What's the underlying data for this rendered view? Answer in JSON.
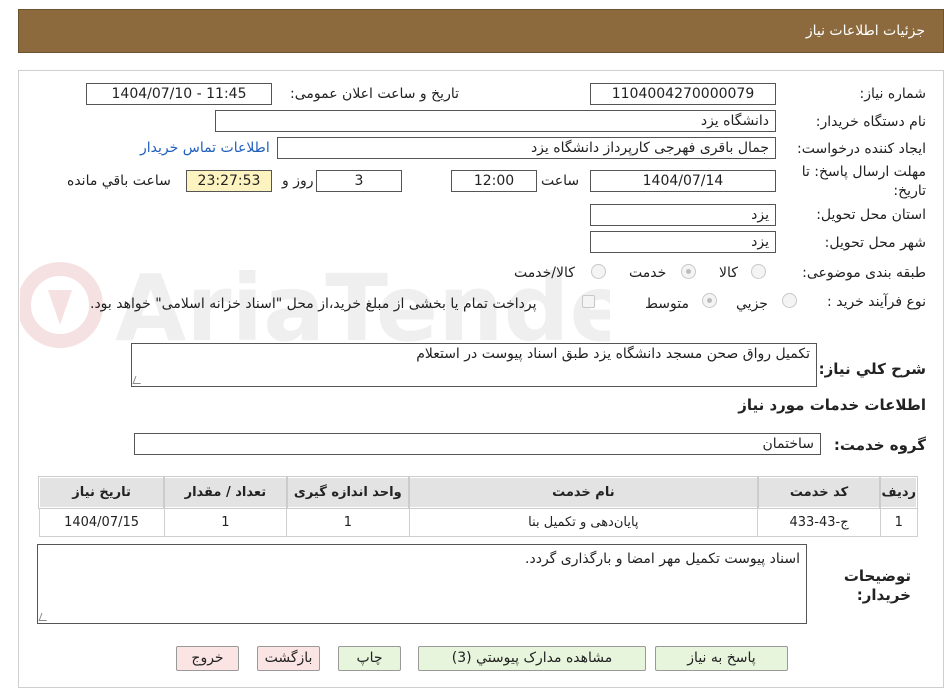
{
  "header": {
    "title": "جزئیات اطلاعات نیاز"
  },
  "form": {
    "need_number_label": "شماره نیاز:",
    "need_number": "1104004270000079",
    "announce_label": "تاریخ و ساعت اعلان عمومی:",
    "announce_value": "1404/07/10 - 11:45",
    "buyer_org_label": "نام دستگاه خریدار:",
    "buyer_org": "دانشگاه یزد",
    "creator_label": "ایجاد کننده درخواست:",
    "creator": "جمال باقری فهرجی کارپرداز دانشگاه یزد",
    "contact_link": "اطلاعات تماس خریدار",
    "deadline_label_1": "مهلت ارسال پاسخ: تا",
    "deadline_label_2": "تاریخ:",
    "deadline_date": "1404/07/14",
    "time_label": "ساعت",
    "deadline_time": "12:00",
    "days": "3",
    "days_label": "روز و",
    "remaining": "23:27:53",
    "remaining_label": "ساعت باقي مانده",
    "province_label": "استان محل تحویل:",
    "province": "یزد",
    "city_label": "شهر محل تحویل:",
    "city": "یزد",
    "category_label": "طبقه بندی موضوعی:",
    "category_options": [
      "کالا",
      "خدمت",
      "کالا/خدمت"
    ],
    "process_label": "نوع فرآیند خرید :",
    "process_options": [
      "جزيي",
      "متوسط"
    ],
    "payment_note": "پرداخت تمام یا بخشی از مبلغ خرید،از محل \"اسناد خزانه اسلامی\" خواهد بود.",
    "summary_label": "شرح کلي نیاز:",
    "summary": "تکمیل رواق صحن مسجد دانشگاه یزد طبق اسناد پیوست در استعلام",
    "services_heading": "اطلاعات خدمات مورد نیاز",
    "service_group_label": "گروه خدمت:",
    "service_group": "ساختمان"
  },
  "table": {
    "headers": [
      "ردیف",
      "کد خدمت",
      "نام خدمت",
      "واحد اندازه گیری",
      "تعداد / مقدار",
      "تاریخ نیاز"
    ],
    "rows": [
      [
        "1",
        "ج-43-433",
        "پایان‌دهی و تکمیل بنا",
        "1",
        "1",
        "1404/07/15"
      ]
    ]
  },
  "notes": {
    "label_1": "توضیحات",
    "label_2": "خریدار:",
    "text": "اسناد پیوست تکمیل مهر امضا و بارگذاری گردد."
  },
  "buttons": {
    "reply": "پاسخ به نیاز",
    "attachments": "مشاهده مدارک پیوستي (3)",
    "print": "چاپ",
    "back": "بازگشت",
    "exit": "خروج"
  },
  "watermark": {
    "text": "AriaTender.neT"
  }
}
